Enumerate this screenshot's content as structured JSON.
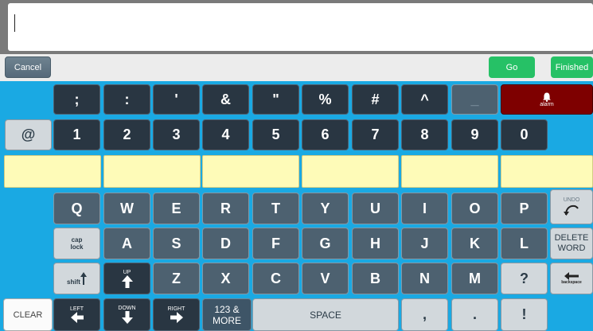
{
  "topbar": {
    "cancel": "Cancel",
    "go": "Go",
    "finished": "Finished"
  },
  "text_field": {
    "value": ""
  },
  "symbols": [
    ";",
    ":",
    "'",
    "&",
    "\"",
    "%",
    "#",
    "^",
    "_"
  ],
  "alarm": {
    "label": "alarm",
    "icon": "bell-icon"
  },
  "at": "@",
  "digits": [
    "1",
    "2",
    "3",
    "4",
    "5",
    "6",
    "7",
    "8",
    "9",
    "0"
  ],
  "row_q": [
    "Q",
    "W",
    "E",
    "R",
    "T",
    "Y",
    "U",
    "I",
    "O",
    "P"
  ],
  "row_a": [
    "A",
    "S",
    "D",
    "F",
    "G",
    "H",
    "J",
    "K",
    "L"
  ],
  "row_z": [
    "Z",
    "X",
    "C",
    "V",
    "B",
    "N",
    "M",
    "?"
  ],
  "special": {
    "undo": "UNDO",
    "cap_lock": "cap lock",
    "delete_word": "DELETE WORD",
    "shift": "shift",
    "up": "UP",
    "backspace": "backspace",
    "clear": "CLEAR",
    "left": "LEFT",
    "down": "DOWN",
    "right": "RIGHT",
    "more_line1": "123 &",
    "more_line2": "MORE",
    "space": "SPACE",
    "comma": ",",
    "period": ".",
    "exclaim": "!"
  },
  "colors": {
    "background": "#1aa9e3",
    "dark_key": "#293642",
    "mid_key": "#4d6170",
    "light_key": "#d2d8dc",
    "alarm": "#7e0000",
    "suggestion": "#fefbb8",
    "go": "#26c166"
  }
}
